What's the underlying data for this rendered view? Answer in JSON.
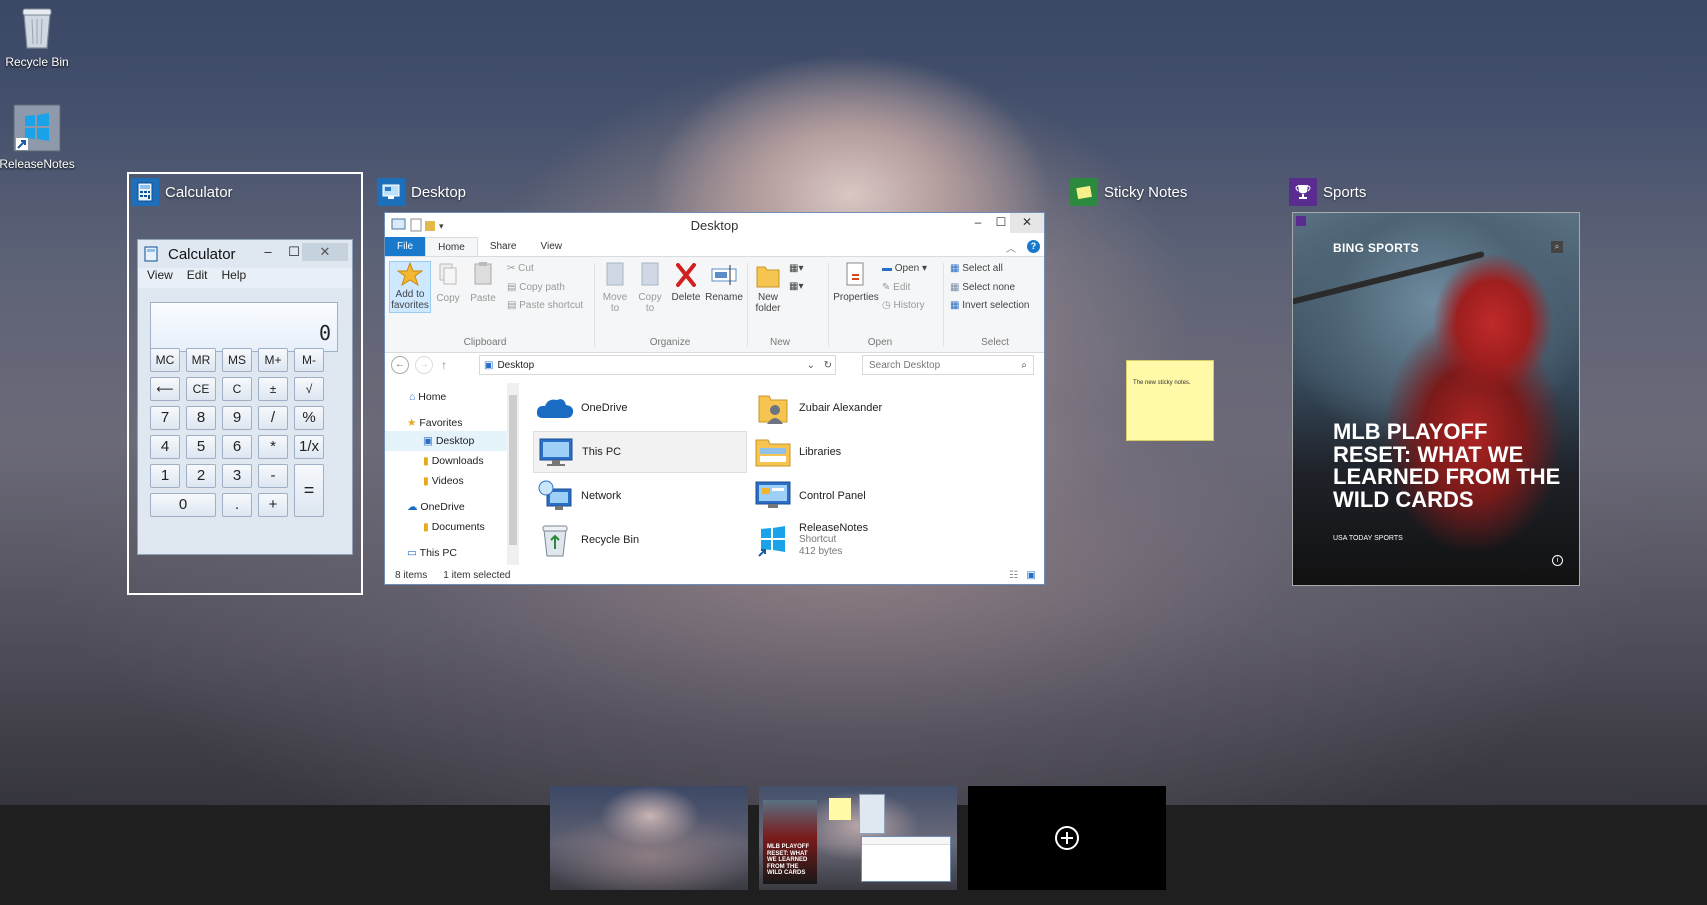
{
  "desktop": {
    "icons": [
      {
        "label": "Recycle Bin",
        "icon": "recycle-bin-icon"
      },
      {
        "label": "ReleaseNotes",
        "icon": "windows-logo-shortcut-icon"
      }
    ]
  },
  "task_view": {
    "windows": [
      {
        "title": "Calculator",
        "icon": "calculator-icon"
      },
      {
        "title": "Desktop",
        "icon": "desktop-icon"
      },
      {
        "title": "Sticky Notes",
        "icon": "sticky-notes-icon"
      },
      {
        "title": "Sports",
        "icon": "trophy-icon"
      }
    ]
  },
  "calculator": {
    "title": "Calculator",
    "controls": {
      "minimize": "‒",
      "maximize": "☐",
      "close": "✕"
    },
    "menu": [
      "View",
      "Edit",
      "Help"
    ],
    "display": "0",
    "keys": [
      [
        "MC",
        "MR",
        "MS",
        "M+",
        "M-"
      ],
      [
        "⟵",
        "CE",
        "C",
        "±",
        "√"
      ],
      [
        "7",
        "8",
        "9",
        "/",
        "%"
      ],
      [
        "4",
        "5",
        "6",
        "*",
        "1/x"
      ],
      [
        "1",
        "2",
        "3",
        "-",
        "="
      ],
      [
        "0",
        ".",
        "+"
      ]
    ]
  },
  "explorer": {
    "title": "Desktop",
    "tabs": [
      "File",
      "Home",
      "Share",
      "View"
    ],
    "ribbon": {
      "clipboard": {
        "pin": "Add to favorites",
        "copy": "Copy",
        "paste": "Paste",
        "cut": "Cut",
        "copy_path": "Copy path",
        "paste_shortcut": "Paste shortcut",
        "label": "Clipboard"
      },
      "organize": {
        "move_to": "Move to",
        "copy_to": "Copy to",
        "delete": "Delete",
        "rename": "Rename",
        "label": "Organize"
      },
      "new": {
        "new_folder": "New folder",
        "label": "New"
      },
      "open": {
        "properties": "Properties",
        "open": "Open",
        "edit": "Edit",
        "history": "History",
        "label": "Open"
      },
      "select": {
        "select_all": "Select all",
        "select_none": "Select none",
        "invert": "Invert selection",
        "label": "Select"
      }
    },
    "address": "Desktop",
    "search_placeholder": "Search Desktop",
    "nav": [
      "Home",
      "Favorites",
      "Desktop",
      "Downloads",
      "Videos",
      "OneDrive",
      "Documents",
      "This PC"
    ],
    "files": [
      {
        "name": "OneDrive",
        "icon": "onedrive-cloud-icon"
      },
      {
        "name": "Zubair Alexander",
        "icon": "user-folder-icon"
      },
      {
        "name": "This PC",
        "icon": "computer-icon"
      },
      {
        "name": "Libraries",
        "icon": "libraries-icon"
      },
      {
        "name": "Network",
        "icon": "network-icon"
      },
      {
        "name": "Control Panel",
        "icon": "control-panel-icon"
      },
      {
        "name": "Recycle Bin",
        "icon": "recycle-bin-icon"
      },
      {
        "name": "ReleaseNotes",
        "sub1": "Shortcut",
        "sub2": "412 bytes",
        "icon": "windows-logo-shortcut-icon"
      }
    ],
    "status": {
      "count": "8 items",
      "selected": "1 item selected"
    }
  },
  "sticky_note": {
    "text": "The new sticky notes."
  },
  "sports": {
    "brand": "BING SPORTS",
    "headline": "MLB PLAYOFF RESET: WHAT WE LEARNED FROM THE WILD CARDS",
    "source": "USA TODAY SPORTS"
  },
  "virtual_desktops": {
    "add_icon": "plus-circle-icon",
    "colors": {
      "accent": "#1979ca",
      "taskbar": "#1f1f1f"
    }
  }
}
